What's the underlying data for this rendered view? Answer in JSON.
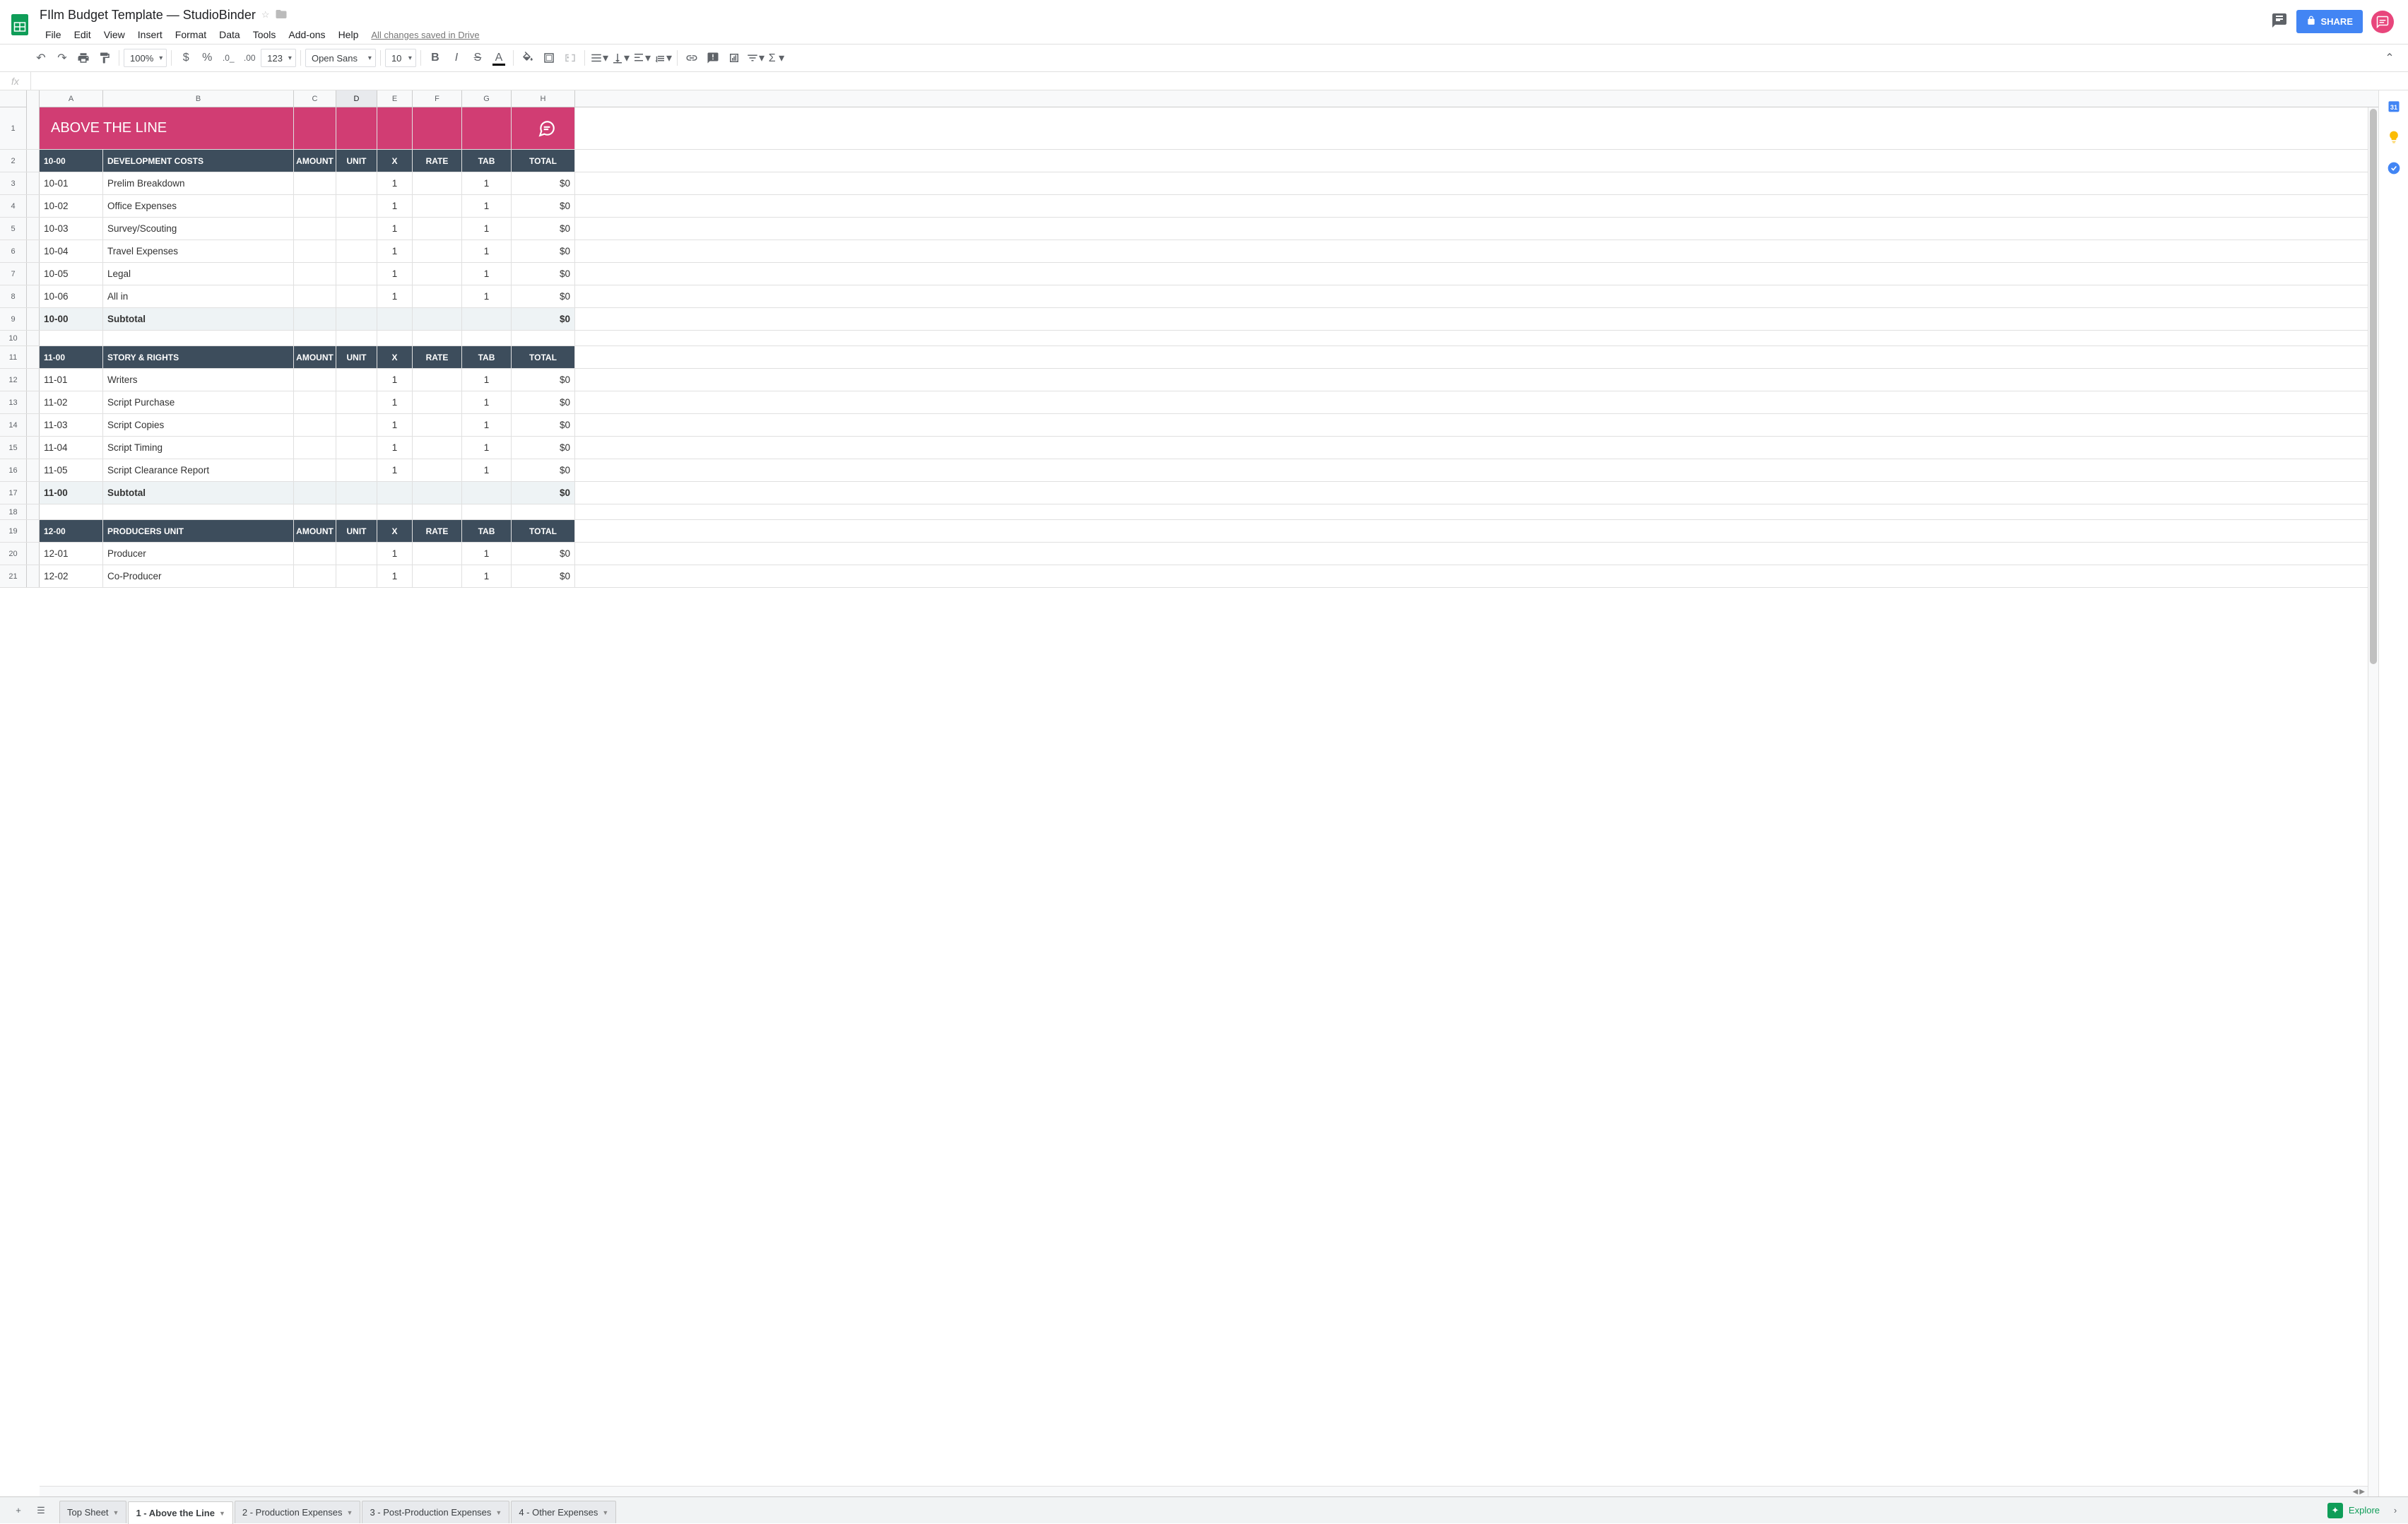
{
  "header": {
    "doc_title": "FIlm Budget Template — StudioBinder",
    "menu": [
      "File",
      "Edit",
      "View",
      "Insert",
      "Format",
      "Data",
      "Tools",
      "Add-ons",
      "Help"
    ],
    "drive_status": "All changes saved in Drive",
    "share_label": "SHARE"
  },
  "toolbar": {
    "zoom": "100%",
    "font": "Open Sans",
    "font_size": "10",
    "num_fmt": "123"
  },
  "columns": [
    "A",
    "B",
    "C",
    "D",
    "E",
    "F",
    "G",
    "H"
  ],
  "selected_col": "D",
  "banner_title": "ABOVE THE LINE",
  "section_headers": [
    "AMOUNT",
    "UNIT",
    "X",
    "RATE",
    "TAB",
    "TOTAL"
  ],
  "sections": [
    {
      "code": "10-00",
      "title": "DEVELOPMENT COSTS",
      "rows": [
        {
          "n": "3",
          "code": "10-01",
          "desc": "Prelim Breakdown",
          "x": "1",
          "tab": "1",
          "total": "$0"
        },
        {
          "n": "4",
          "code": "10-02",
          "desc": "Office Expenses",
          "x": "1",
          "tab": "1",
          "total": "$0"
        },
        {
          "n": "5",
          "code": "10-03",
          "desc": "Survey/Scouting",
          "x": "1",
          "tab": "1",
          "total": "$0"
        },
        {
          "n": "6",
          "code": "10-04",
          "desc": "Travel Expenses",
          "x": "1",
          "tab": "1",
          "total": "$0"
        },
        {
          "n": "7",
          "code": "10-05",
          "desc": "Legal",
          "x": "1",
          "tab": "1",
          "total": "$0"
        },
        {
          "n": "8",
          "code": "10-06",
          "desc": "All in",
          "x": "1",
          "tab": "1",
          "total": "$0"
        }
      ],
      "subtotal": {
        "n": "9",
        "code": "10-00",
        "label": "Subtotal",
        "total": "$0"
      },
      "header_row": "2",
      "spacer_row": "10"
    },
    {
      "code": "11-00",
      "title": "STORY & RIGHTS",
      "rows": [
        {
          "n": "12",
          "code": "11-01",
          "desc": "Writers",
          "x": "1",
          "tab": "1",
          "total": "$0"
        },
        {
          "n": "13",
          "code": "11-02",
          "desc": "Script Purchase",
          "x": "1",
          "tab": "1",
          "total": "$0"
        },
        {
          "n": "14",
          "code": "11-03",
          "desc": "Script Copies",
          "x": "1",
          "tab": "1",
          "total": "$0"
        },
        {
          "n": "15",
          "code": "11-04",
          "desc": "Script Timing",
          "x": "1",
          "tab": "1",
          "total": "$0"
        },
        {
          "n": "16",
          "code": "11-05",
          "desc": "Script Clearance Report",
          "x": "1",
          "tab": "1",
          "total": "$0"
        }
      ],
      "subtotal": {
        "n": "17",
        "code": "11-00",
        "label": "Subtotal",
        "total": "$0"
      },
      "header_row": "11",
      "spacer_row": "18"
    },
    {
      "code": "12-00",
      "title": "PRODUCERS UNIT",
      "rows": [
        {
          "n": "20",
          "code": "12-01",
          "desc": "Producer",
          "x": "1",
          "tab": "1",
          "total": "$0"
        },
        {
          "n": "21",
          "code": "12-02",
          "desc": "Co-Producer",
          "x": "1",
          "tab": "1",
          "total": "$0"
        }
      ],
      "header_row": "19"
    }
  ],
  "sheet_tabs": [
    {
      "label": "Top Sheet",
      "active": false
    },
    {
      "label": "1 - Above the Line",
      "active": true
    },
    {
      "label": "2 - Production Expenses",
      "active": false
    },
    {
      "label": "3 - Post-Production Expenses",
      "active": false
    },
    {
      "label": "4 - Other Expenses",
      "active": false
    }
  ],
  "explore_label": "Explore"
}
